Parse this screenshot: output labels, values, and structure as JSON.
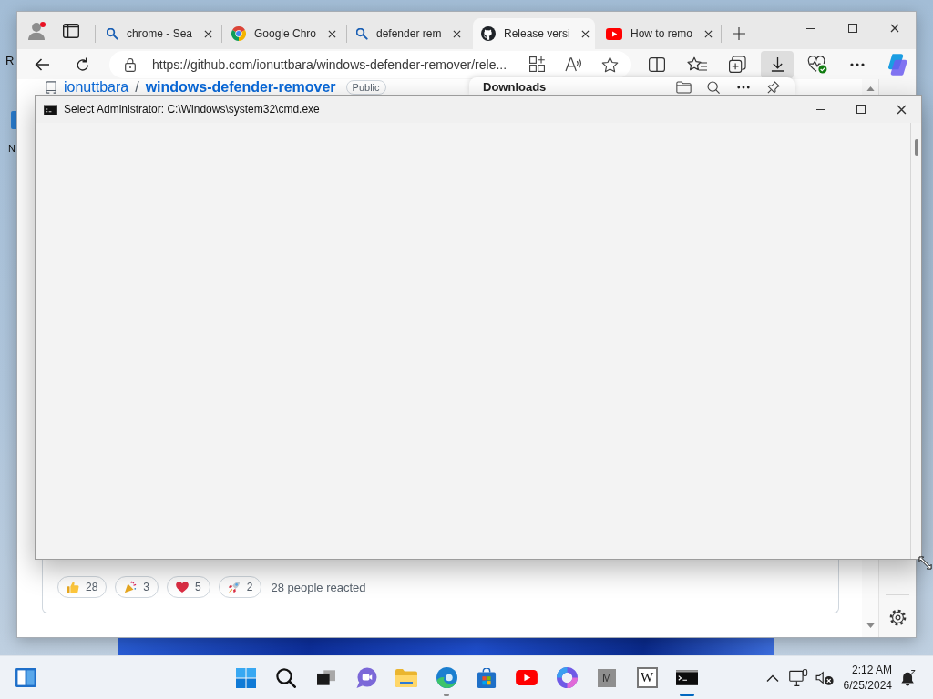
{
  "desktop": {
    "icons": [
      {
        "label": "R"
      },
      {
        "label": "N"
      }
    ]
  },
  "browser": {
    "profile": {
      "notification": true
    },
    "tabs": [
      {
        "kind": "search",
        "title": "chrome - Sea",
        "selected": false
      },
      {
        "kind": "chrome",
        "title": "Google Chro",
        "selected": false
      },
      {
        "kind": "search",
        "title": "defender rem",
        "selected": false
      },
      {
        "kind": "github",
        "title": "Release versi",
        "selected": true
      },
      {
        "kind": "youtube",
        "title": "How to remo",
        "selected": false
      }
    ],
    "address_bar": {
      "url": "https://github.com/ionuttbara/windows-defender-remover/rele..."
    },
    "toolbar_buttons": [
      {
        "kind": "split-screen",
        "selected": false
      },
      {
        "kind": "favorites",
        "selected": false
      },
      {
        "kind": "collections",
        "selected": false
      },
      {
        "kind": "downloads",
        "selected": true
      },
      {
        "kind": "browser-essentials",
        "selected": false
      },
      {
        "kind": "more",
        "selected": false
      },
      {
        "kind": "copilot",
        "selected": false
      }
    ],
    "downloads_panel": {
      "title": "Downloads"
    },
    "page": {
      "repo_owner": "ionuttbara",
      "separator": "/",
      "repo_name": "windows-defender-remover",
      "visibility": "Public",
      "reactions": [
        {
          "kind": "thumbs-up",
          "count": "28"
        },
        {
          "kind": "hooray",
          "count": "3"
        },
        {
          "kind": "heart",
          "count": "5"
        },
        {
          "kind": "rocket",
          "count": "2"
        }
      ],
      "reaction_summary": "28 people reacted"
    }
  },
  "console_window": {
    "title": "Select Administrator: C:\\Windows\\system32\\cmd.exe"
  },
  "taskbar": {
    "apps": [
      {
        "kind": "start",
        "running": false,
        "focused": false
      },
      {
        "kind": "search",
        "running": false,
        "focused": false
      },
      {
        "kind": "task-view",
        "running": false,
        "focused": false
      },
      {
        "kind": "chat",
        "running": false,
        "focused": false
      },
      {
        "kind": "file-explorer",
        "running": false,
        "focused": false
      },
      {
        "kind": "edge",
        "running": true,
        "focused": false
      },
      {
        "kind": "store",
        "running": false,
        "focused": false
      },
      {
        "kind": "youtube",
        "running": false,
        "focused": false
      },
      {
        "kind": "ring-app",
        "running": false,
        "focused": false
      },
      {
        "kind": "letter-tile",
        "letter": "M",
        "running": false,
        "focused": false
      },
      {
        "kind": "wiki-tile",
        "letter": "W",
        "running": false,
        "focused": false
      },
      {
        "kind": "terminal",
        "running": true,
        "focused": true
      }
    ],
    "clock": {
      "time": "2:12 AM",
      "date": "6/25/2024"
    }
  }
}
